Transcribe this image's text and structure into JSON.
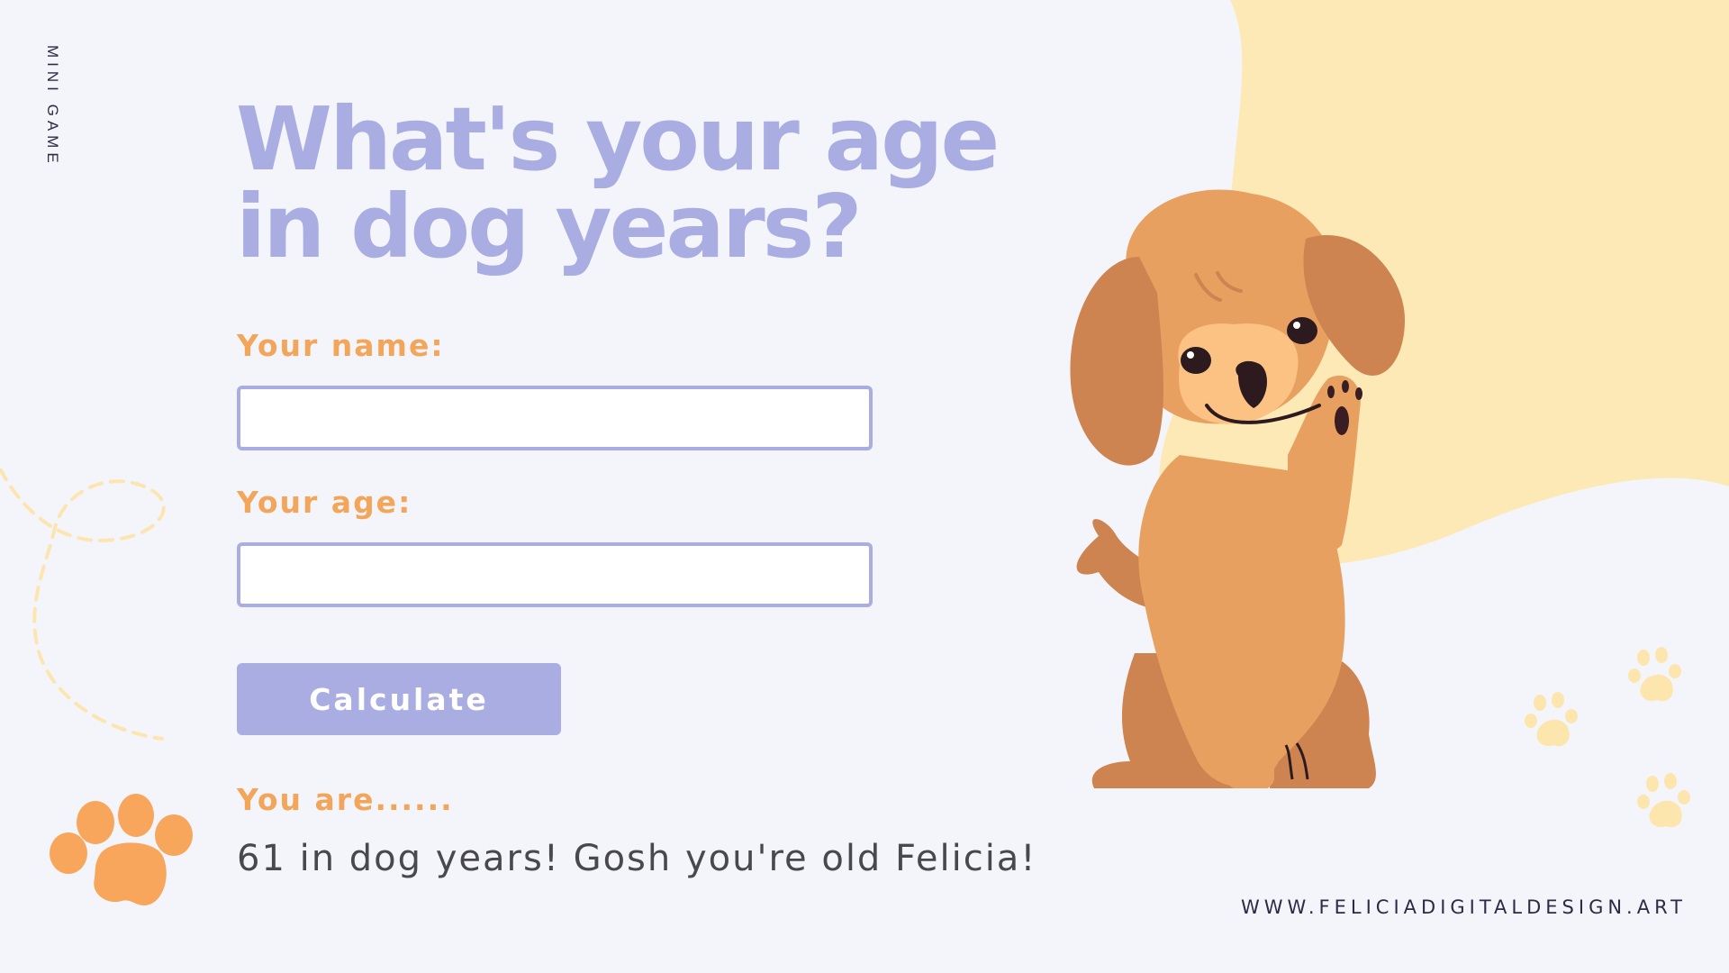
{
  "side_label": "MINI GAME",
  "title_line1": "What's your age",
  "title_line2": "in dog years?",
  "form": {
    "name_label": "Your name:",
    "name_value": "",
    "age_label": "Your age:",
    "age_value": "",
    "calculate_label": "Calculate"
  },
  "result": {
    "label": "You are......",
    "text": "61 in dog years! Gosh you're old Felicia!"
  },
  "website": "WWW.FELICIADIGITALDESIGN.ART",
  "colors": {
    "background": "#f4f5fb",
    "accent_lavender": "#a9ade2",
    "accent_orange": "#f3a55a",
    "blob_yellow": "#fde9b6",
    "text_dark": "#49484f"
  },
  "icons": [
    "paw-print-icon",
    "dog-illustration",
    "dashed-loop-decoration"
  ]
}
